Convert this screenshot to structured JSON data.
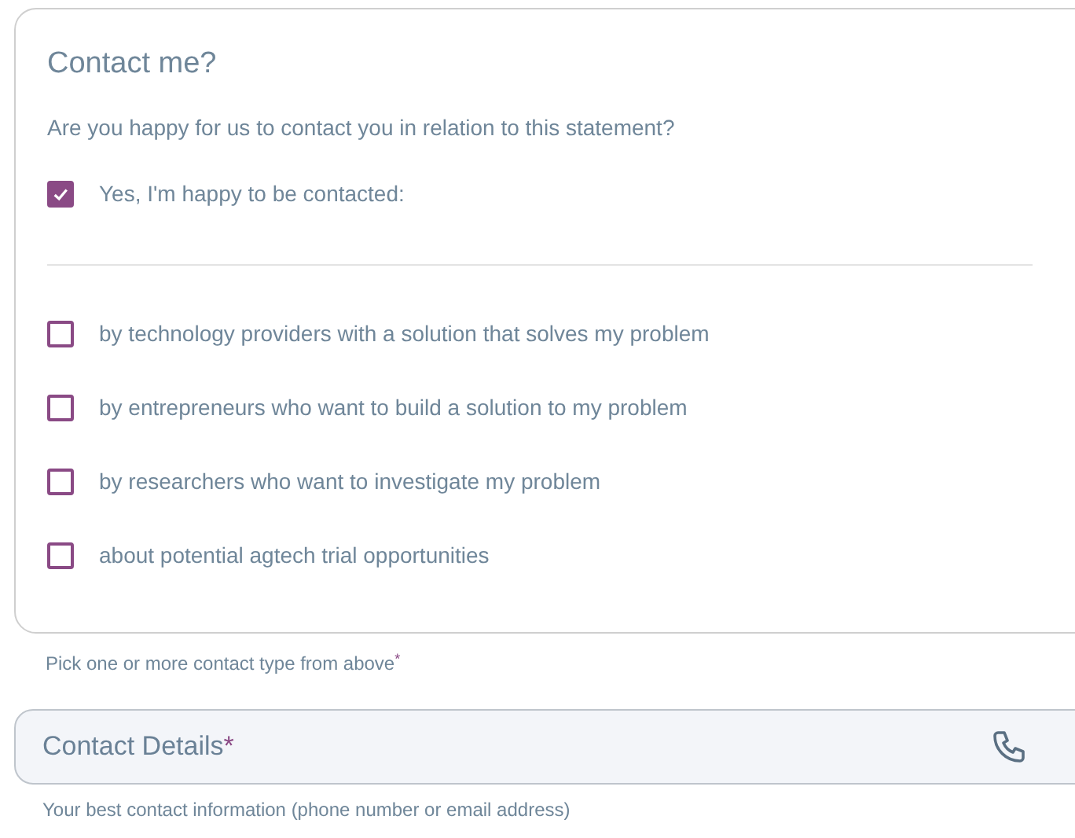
{
  "section": {
    "title": "Contact me?",
    "question": "Are you happy for us to contact you in relation to this statement?",
    "consent": {
      "label": "Yes, I'm happy to be contacted:",
      "checked": true
    },
    "options": [
      {
        "label": "by technology providers with a solution that solves my problem",
        "checked": false
      },
      {
        "label": "by entrepreneurs who want to build a solution to my problem",
        "checked": false
      },
      {
        "label": "by researchers who want to investigate my problem",
        "checked": false
      },
      {
        "label": "about potential agtech trial opportunities",
        "checked": false
      }
    ]
  },
  "options_hint": {
    "text": "Pick one or more contact type from above",
    "required_mark": "*"
  },
  "contact_field": {
    "placeholder": "Contact Details",
    "required_mark": "*",
    "hint": "Your best contact information (phone number or email address)"
  }
}
